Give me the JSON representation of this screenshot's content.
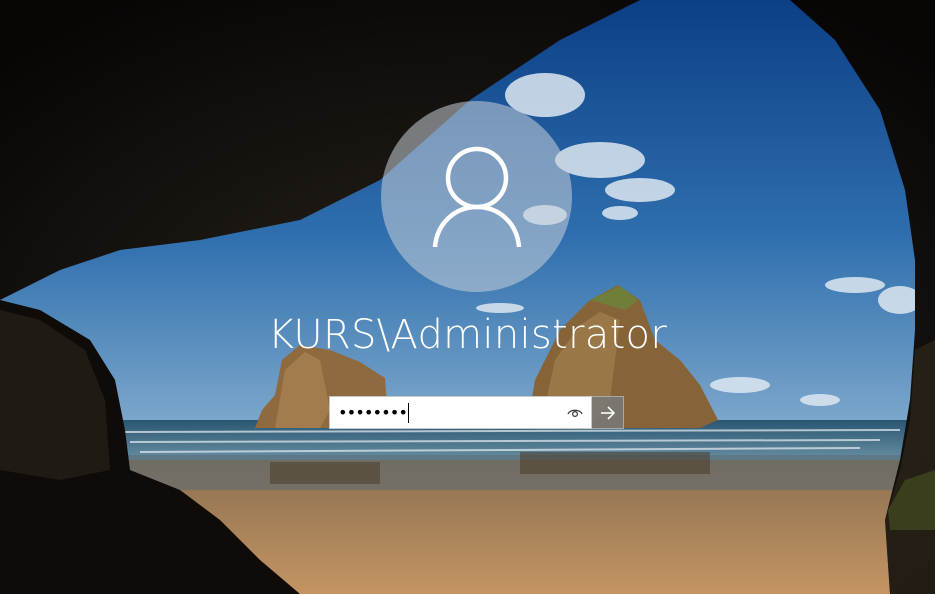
{
  "login": {
    "username": "KURS\\Administrator",
    "password_masked": "••••••••"
  },
  "icons": {
    "avatar": "user-silhouette-icon",
    "reveal": "eye-icon",
    "submit": "arrow-right-icon"
  },
  "colors": {
    "sky": "#1f5fa5",
    "sand": "#b08a5c",
    "cave": "#141210",
    "text": "#ffffff"
  }
}
